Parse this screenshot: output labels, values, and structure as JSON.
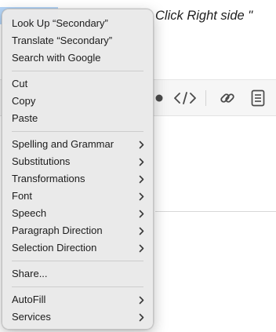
{
  "background": {
    "heading_fragment": "Click Right side \"",
    "toolbar": {
      "icons": [
        "bullet-icon",
        "code-icon",
        "link-icon",
        "document-icon"
      ]
    }
  },
  "context_menu": {
    "items": [
      {
        "label": "Look Up “Secondary”"
      },
      {
        "label": "Translate “Secondary”"
      },
      {
        "label": "Search with Google"
      },
      {
        "label": "Cut"
      },
      {
        "label": "Copy"
      },
      {
        "label": "Paste"
      },
      {
        "label": "Spelling and Grammar",
        "submenu": true
      },
      {
        "label": "Substitutions",
        "submenu": true
      },
      {
        "label": "Transformations",
        "submenu": true
      },
      {
        "label": "Font",
        "submenu": true
      },
      {
        "label": "Speech",
        "submenu": true
      },
      {
        "label": "Paragraph Direction",
        "submenu": true
      },
      {
        "label": "Selection Direction",
        "submenu": true
      },
      {
        "label": "Share..."
      },
      {
        "label": "AutoFill",
        "submenu": true
      },
      {
        "label": "Services",
        "submenu": true
      }
    ]
  },
  "colors": {
    "selection": "#b5d5f7",
    "menu_background": "#eaeaea",
    "menu_text": "#1c1c1c"
  }
}
